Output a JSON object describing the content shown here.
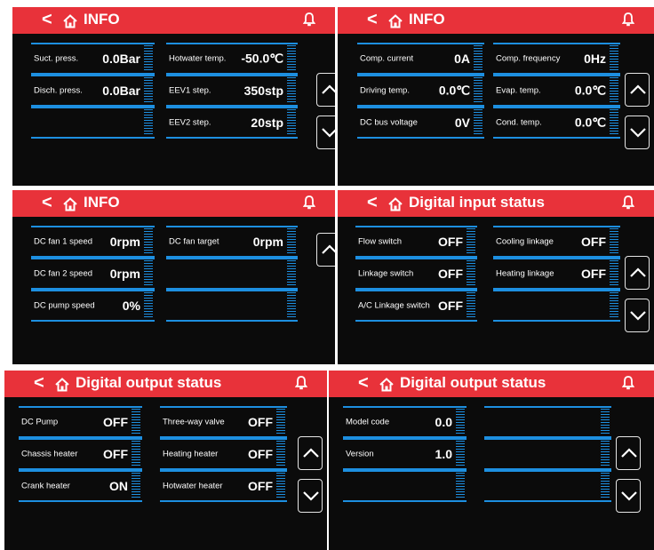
{
  "colors": {
    "header": "#e8323a",
    "background": "#0b0b0b",
    "line": "#1d8fe0",
    "text": "#ffffff"
  },
  "icons": {
    "back": "chevron-left-icon",
    "home": "home-icon",
    "bell": "bell-icon",
    "up": "chevron-up-icon",
    "down": "chevron-down-icon"
  },
  "header": {
    "back_symbol": "<"
  },
  "panels": [
    {
      "title": "INFO",
      "cols": [
        [
          {
            "label": "Suct. press.",
            "value": "0.0Bar"
          },
          {
            "label": "Disch. press.",
            "value": "0.0Bar"
          },
          {
            "label": "",
            "value": ""
          }
        ],
        [
          {
            "label": "Hotwater temp.",
            "value": "-50.0℃"
          },
          {
            "label": "EEV1 step.",
            "value": "350stp"
          },
          {
            "label": "EEV2  step.",
            "value": "20stp"
          }
        ]
      ]
    },
    {
      "title": "INFO",
      "cols": [
        [
          {
            "label": "Comp. current",
            "value": "0A"
          },
          {
            "label": "Driving temp.",
            "value": "0.0℃"
          },
          {
            "label": "DC bus voltage",
            "value": "0V"
          }
        ],
        [
          {
            "label": "Comp. frequency",
            "value": "0Hz"
          },
          {
            "label": "Evap. temp.",
            "value": "0.0℃"
          },
          {
            "label": "Cond. temp.",
            "value": "0.0℃"
          }
        ]
      ]
    },
    {
      "title": "INFO",
      "cols": [
        [
          {
            "label": "DC fan 1 speed",
            "value": "0rpm"
          },
          {
            "label": "DC fan 2 speed",
            "value": "0rpm"
          },
          {
            "label": "DC pump speed",
            "value": "0%"
          }
        ],
        [
          {
            "label": "DC fan target",
            "value": "0rpm"
          },
          {
            "label": "",
            "value": ""
          },
          {
            "label": "",
            "value": ""
          }
        ]
      ]
    },
    {
      "title": "Digital input status",
      "cols": [
        [
          {
            "label": "Flow switch",
            "value": "OFF"
          },
          {
            "label": "Linkage switch",
            "value": "OFF"
          },
          {
            "label": "A/C Linkage switch",
            "value": "OFF"
          }
        ],
        [
          {
            "label": "Cooling linkage",
            "value": "OFF"
          },
          {
            "label": "Heating linkage",
            "value": "OFF"
          },
          {
            "label": "",
            "value": ""
          }
        ]
      ]
    },
    {
      "title": "Digital output status",
      "cols": [
        [
          {
            "label": "DC Pump",
            "value": "OFF"
          },
          {
            "label": "Chassis heater",
            "value": "OFF"
          },
          {
            "label": "Crank heater",
            "value": "ON"
          }
        ],
        [
          {
            "label": "Three-way valve",
            "value": "OFF"
          },
          {
            "label": "Heating  heater",
            "value": "OFF"
          },
          {
            "label": "Hotwater  heater",
            "value": "OFF"
          }
        ]
      ]
    },
    {
      "title": "Digital output status",
      "cols": [
        [
          {
            "label": "Model code",
            "value": "0.0"
          },
          {
            "label": "Version",
            "value": "1.0"
          },
          {
            "label": "",
            "value": ""
          }
        ],
        [
          {
            "label": "",
            "value": ""
          },
          {
            "label": "",
            "value": ""
          },
          {
            "label": "",
            "value": ""
          }
        ]
      ]
    }
  ]
}
